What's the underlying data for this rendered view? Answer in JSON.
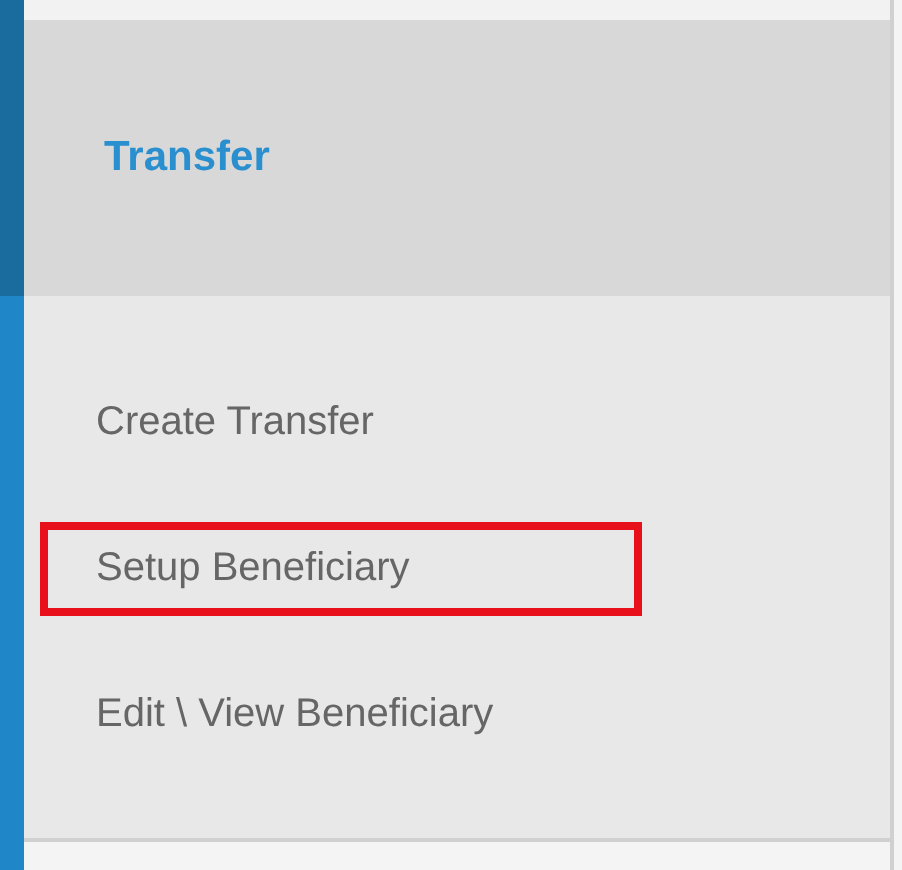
{
  "header": {
    "title": "Transfer"
  },
  "menu": [
    {
      "label": "Create Transfer",
      "highlighted": false
    },
    {
      "label": "Setup Beneficiary",
      "highlighted": true
    },
    {
      "label": "Edit \\ View Beneficiary",
      "highlighted": false
    }
  ]
}
